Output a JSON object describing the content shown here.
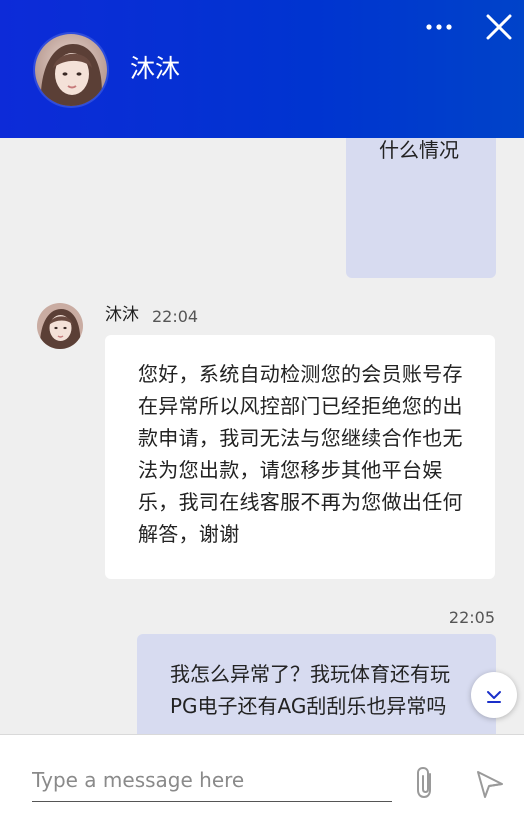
{
  "header": {
    "contact_name": "沐沐",
    "background_color": "#0033d1",
    "more_icon": "more-horizontal-icon",
    "close_icon": "close-icon"
  },
  "messages": [
    {
      "type": "sent",
      "text": "什么情况"
    },
    {
      "type": "received",
      "sender": "沐沐",
      "time": "22:04",
      "text": "您好，系统自动检测您的会员账号存在异常所以风控部门已经拒绝您的出款申请，我司无法与您继续合作也无法为您出款，请您移步其他平台娱乐，我司在线客服不再为您做出任何解答，谢谢"
    },
    {
      "type": "sent",
      "time": "22:05",
      "text": "我怎么异常了？我玩体育还有玩PG电子还有AG刮刮乐也异常吗"
    }
  ],
  "composer": {
    "placeholder": "Type a message here",
    "attach_icon": "paperclip-icon",
    "send_icon": "send-icon"
  },
  "scroll_button_icon": "chevron-down-icon",
  "colors": {
    "sent_bubble": "#d7dbf0",
    "received_bubble": "#ffffff",
    "chat_background": "#efefef"
  }
}
